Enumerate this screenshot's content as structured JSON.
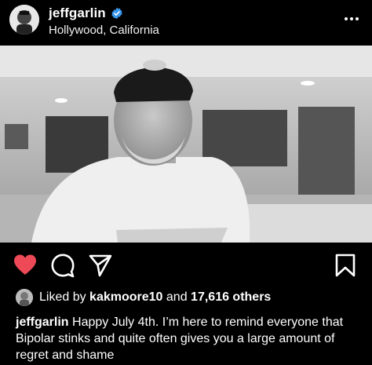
{
  "post": {
    "username": "jeffgarlin",
    "location": "Hollywood, California",
    "verified": true
  },
  "likes": {
    "prefix": "Liked by",
    "user": "kakmoore10",
    "and": "and",
    "count_text": "17,616 others"
  },
  "caption": {
    "username": "jeffgarlin",
    "text": "Happy July 4th. I’m here to remind everyone that Bipolar stinks and quite often gives you a large amount of regret and shame"
  },
  "icons": {
    "more": "more-options-icon",
    "like": "heart-icon",
    "comment": "comment-icon",
    "share": "send-icon",
    "save": "bookmark-icon"
  },
  "colors": {
    "background": "#000000",
    "like_red": "#ed4956",
    "verified_blue": "#3897f0"
  }
}
